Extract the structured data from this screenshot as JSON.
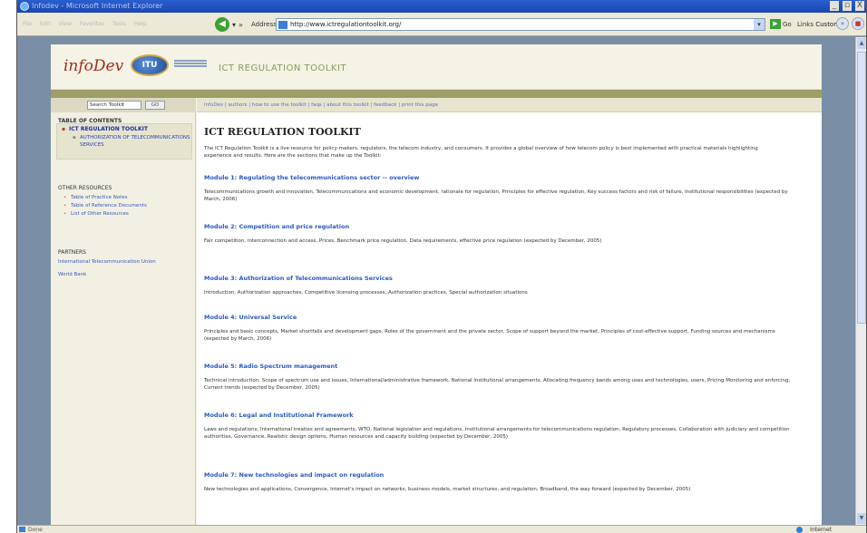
{
  "window": {
    "title": "Infodev - Microsoft Internet Explorer",
    "min": "_",
    "max": "▫",
    "close": "X"
  },
  "menu": [
    "File",
    "Edit",
    "View",
    "Favorites",
    "Tools",
    "Help"
  ],
  "toolbar": {
    "address_label": "Address",
    "url": "http://www.ictregulationtoolkit.org/",
    "go_label": "Go",
    "links_label": "Links",
    "custom_label": "Custom"
  },
  "site": {
    "logo_infodev": "infoDev",
    "logo_itu": "ITU",
    "title": "ICT REGULATION TOOLKIT"
  },
  "sidebar": {
    "search_value": "Search Toolkit",
    "search_button": "GO",
    "toc_heading": "TABLE OF CONTENTS",
    "toc_main": "ICT REGULATION TOOLKIT",
    "toc_sub": "AUTHORIZATION OF TELECOMMUNICATIONS SERVICES",
    "other_heading": "OTHER RESOURCES",
    "other_items": [
      "Table of Practice Notes",
      "Table of Reference Documents",
      "List of Other Resources"
    ],
    "partners_heading": "PARTNERS",
    "partners": [
      "International Telecommunication Union",
      "World Bank"
    ]
  },
  "content": {
    "topnav": "infoDev | authors | how to use the toolkit | faqs | about this toolkit | feedback | print this page",
    "title": "ICT REGULATION TOOLKIT",
    "intro": "The ICT Regulation Toolkit is a live resource for policy-makers, regulators, the telecom industry, and consumers. It provides a global overview of how telecom policy is best implemented with practical materials highlighting experience and results. Here are the sections that make up the Toolkit:",
    "modules": [
      {
        "title": "Module 1: Regulating the telecommunications sector -- overview",
        "desc": "Telecommunications growth and innovation, Telecommunications and economic development, rationale for regulation, Principles for effective regulation, Key success factors and risk of failure, Institutional responsibilities (expected by March, 2006)"
      },
      {
        "title": "Module 2: Competition and price regulation",
        "desc": "Fair competition, Interconnection and access, Prices, Benchmark price regulation, Data requirements, effective price regulation (expected by December, 2005)"
      },
      {
        "title": "Module 3: Authorization of Telecommunications Services",
        "desc": "Introduction, Authorization approaches, Competitive licensing processes, Authorization practices, Special authorization situations"
      },
      {
        "title": "Module 4: Universal Service",
        "desc": "Principles and basic concepts, Market shortfalls and development gaps, Roles of the government and the private sector, Scope of support beyond the market, Principles of cost-effective support, Funding sources and mechanisms (expected by March, 2006)"
      },
      {
        "title": "Module 5: Radio Spectrum management",
        "desc": "Technical introduction, Scope of spectrum use and issues, International/administrative framework, National institutional arrangements, Allocating frequency bands among uses and technologies, users, Pricing Monitoring and enforcing, Current trends (expected by December, 2005)"
      },
      {
        "title": "Module 6: Legal and Institutional Framework",
        "desc": "Laws and regulations, International treaties and agreements, WTO, National legislation and regulations, Institutional arrangements for telecommunications regulation, Regulatory processes, Collaboration with judiciary and competition authorities, Governance, Realistic design options, Human resources and capacity building (expected by December, 2005)"
      },
      {
        "title": "Module 7: New technologies and impact on regulation",
        "desc": "New technologies and applications, Convergence, Internet's impact on networks, business models, market structures, and regulation, Broadband, the way forward (expected by December, 2005)"
      }
    ]
  },
  "status": {
    "left": "Done",
    "zone": "Internet"
  }
}
